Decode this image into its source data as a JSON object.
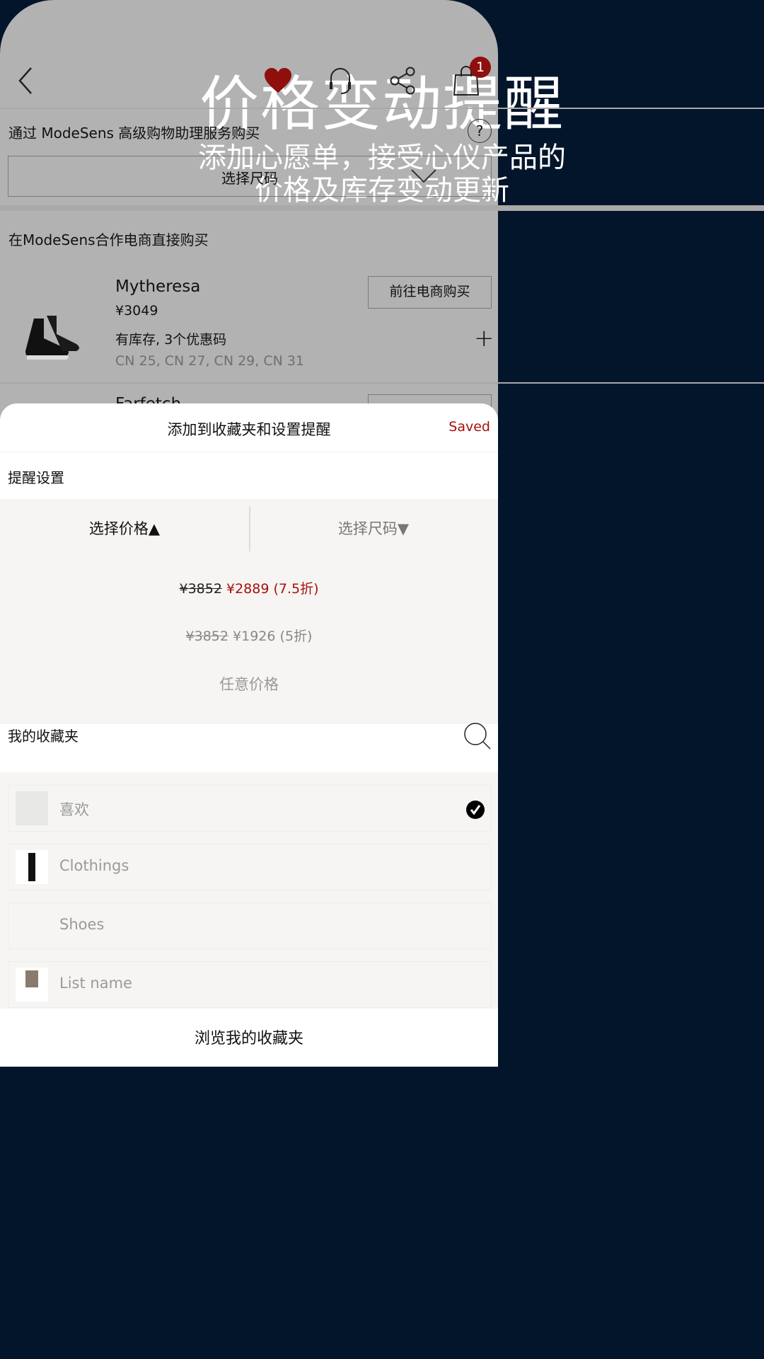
{
  "promo": {
    "title": "价格变动提醒",
    "subtitle_line1": "添加心愿单，接受心仪产品的",
    "subtitle_line2": "价格及库存变动更新"
  },
  "nav": {
    "cart_badge": "1",
    "icons": [
      "chevron-left-icon",
      "heart-icon",
      "headset-icon",
      "share-icon",
      "shopping-bag-icon"
    ]
  },
  "concierge": {
    "label": "通过 ModeSens 高级购物助理服务购买",
    "help": "?",
    "size_select": "选择尺码"
  },
  "partners": {
    "heading": "在ModeSens合作电商直接购买",
    "items": [
      {
        "store": "Mytheresa",
        "price": "¥3049",
        "stock": "有库存, 3个优惠码",
        "sizes": "CN 25, CN 27, CN 29, CN 31",
        "button": "前往电商购买"
      },
      {
        "store": "Farfetch"
      }
    ]
  },
  "sheet": {
    "title": "添加到收藏夹和设置提醒",
    "saved": "Saved",
    "alert_heading": "提醒设置",
    "tabs": [
      {
        "label": "选择价格▲",
        "active": true
      },
      {
        "label": "选择尺码▼",
        "active": false
      }
    ],
    "price_options": [
      {
        "original": "¥3852",
        "target": "¥2889 (7.5折)",
        "selected": true
      },
      {
        "original": "¥3852",
        "target": "¥1926 (5折)",
        "selected": false
      },
      {
        "label": "任意价格"
      }
    ],
    "lists_heading": "我的收藏夹",
    "lists": [
      {
        "name": "喜欢",
        "checked": true
      },
      {
        "name": "Clothings",
        "checked": false
      },
      {
        "name": "Shoes",
        "checked": false
      },
      {
        "name": "List name",
        "checked": false
      }
    ],
    "browse_button": "浏览我的收藏夹"
  },
  "colors": {
    "background": "#03152a",
    "accent_red": "#a5100e"
  }
}
